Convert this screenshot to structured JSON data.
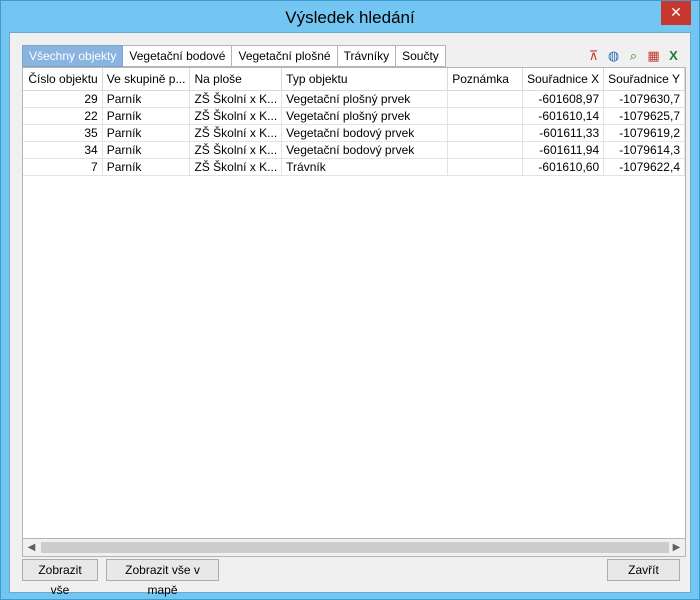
{
  "window": {
    "title": "Výsledek hledání",
    "close": "✕"
  },
  "tabs": [
    "Všechny objekty",
    "Vegetační bodové",
    "Vegetační plošné",
    "Trávníky",
    "Součty"
  ],
  "toolbar": {
    "icons": [
      "filter-icon",
      "globe-search-icon",
      "zoom-map-icon",
      "table-grid-icon",
      "excel-export-icon"
    ]
  },
  "table": {
    "columns": [
      "Číslo objektu",
      "Ve skupině p...",
      "Na ploše",
      "Typ objektu",
      "Poznámka",
      "Souřadnice X",
      "Souřadnice Y"
    ],
    "rows": [
      [
        "29",
        "Parník",
        "ZŠ Školní x K...",
        "Vegetační plošný prvek",
        "",
        "-601608,97",
        "-1079630,7"
      ],
      [
        "22",
        "Parník",
        "ZŠ Školní x K...",
        "Vegetační plošný prvek",
        "",
        "-601610,14",
        "-1079625,7"
      ],
      [
        "35",
        "Parník",
        "ZŠ Školní x K...",
        "Vegetační bodový prvek",
        "",
        "-601611,33",
        "-1079619,2"
      ],
      [
        "34",
        "Parník",
        "ZŠ Školní x K...",
        "Vegetační bodový prvek",
        "",
        "-601611,94",
        "-1079614,3"
      ],
      [
        "7",
        "Parník",
        "ZŠ Školní x K...",
        "Trávník",
        "",
        "-601610,60",
        "-1079622,4"
      ]
    ]
  },
  "buttons": {
    "show_all": "Zobrazit vše",
    "show_all_map": "Zobrazit vše v mapě",
    "close": "Zavřít"
  }
}
